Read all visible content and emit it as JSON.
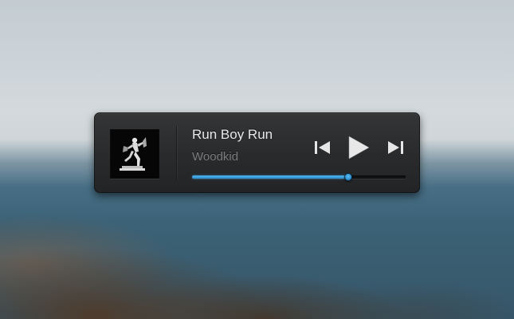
{
  "player": {
    "track_title": "Run Boy Run",
    "artist": "Woodkid",
    "progress": 0.73,
    "accent_color": "#3a9fe0"
  },
  "controls": {
    "previous_icon": "skip-previous-icon",
    "play_icon": "play-icon",
    "next_icon": "skip-next-icon"
  },
  "album_art": {
    "icon": "album-art-statue-icon"
  }
}
